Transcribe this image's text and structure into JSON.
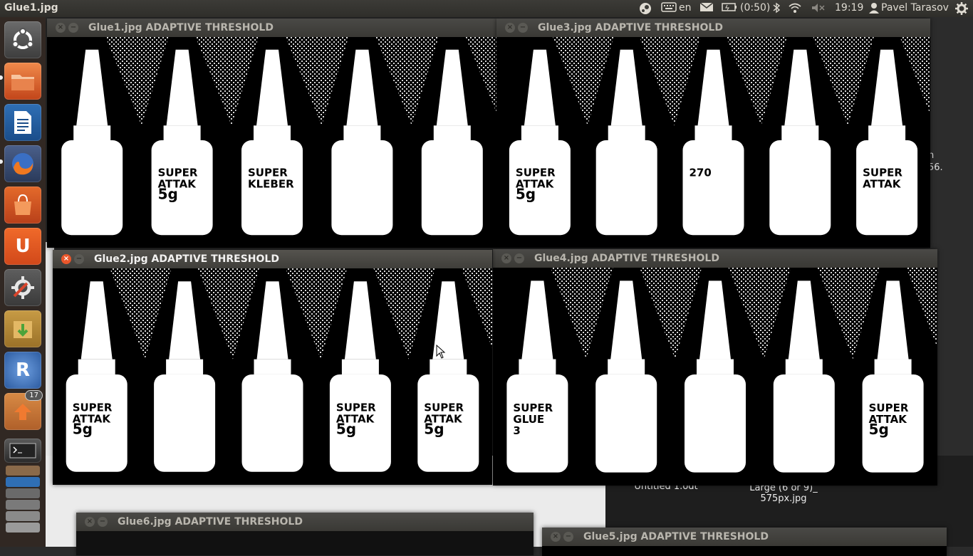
{
  "top_panel": {
    "app_title": "Glue1.jpg",
    "keyboard_layout": "en",
    "battery": "(0:50)",
    "clock": "19:19",
    "user": "Pavel Tarasov",
    "icons": [
      "steam-icon",
      "keyboard-icon",
      "mail-icon",
      "battery-icon",
      "bluetooth-icon",
      "wifi-icon",
      "volume-muted-icon",
      "user-icon",
      "gear-icon"
    ]
  },
  "launcher": {
    "items": [
      {
        "name": "ubuntu-dash"
      },
      {
        "name": "files"
      },
      {
        "name": "libreoffice-writer"
      },
      {
        "name": "firefox"
      },
      {
        "name": "software-center"
      },
      {
        "name": "ubuntu-one"
      },
      {
        "name": "system-settings"
      },
      {
        "name": "archive-manager"
      },
      {
        "name": "rstudio",
        "glyph": "R"
      },
      {
        "name": "update-manager",
        "badge": "17"
      },
      {
        "name": "terminal"
      },
      {
        "name": "workspace-stack"
      }
    ]
  },
  "windows": [
    {
      "title": "Glue1.jpg ADAPTIVE THRESHOLD",
      "labels": [
        "",
        "SUPER ATTAK 5g",
        "SUPER KLEBER",
        "",
        ""
      ]
    },
    {
      "title": "Glue3.jpg ADAPTIVE THRESHOLD",
      "labels": [
        "SUPER ATTAK 5g",
        "",
        "270",
        "",
        "SUPER ATTAK"
      ]
    },
    {
      "title": "Glue2.jpg ADAPTIVE THRESHOLD",
      "labels": [
        "SUPER ATTAK 5g",
        "",
        "",
        "SUPER ATTAK 5g",
        "SUPER ATTAK 5g"
      ]
    },
    {
      "title": "Glue4.jpg ADAPTIVE THRESHOLD",
      "labels": [
        "SUPER GLUE 3",
        "",
        "",
        "",
        "SUPER ATTAK 5g"
      ]
    },
    {
      "title": "Glue6.jpg ADAPTIVE THRESHOLD"
    },
    {
      "title": "Glue5.jpg ADAPTIVE THRESHOLD"
    }
  ],
  "desktop": {
    "file1": "Untitled 1.odt",
    "file2_line1": "Large (6 or 9)_",
    "file2_line2": "575px.jpg",
    "edge_text_1": "n",
    "edge_text_2": "56."
  },
  "colors": {
    "close_active": "#e9562b",
    "panel": "#3c3b37"
  }
}
